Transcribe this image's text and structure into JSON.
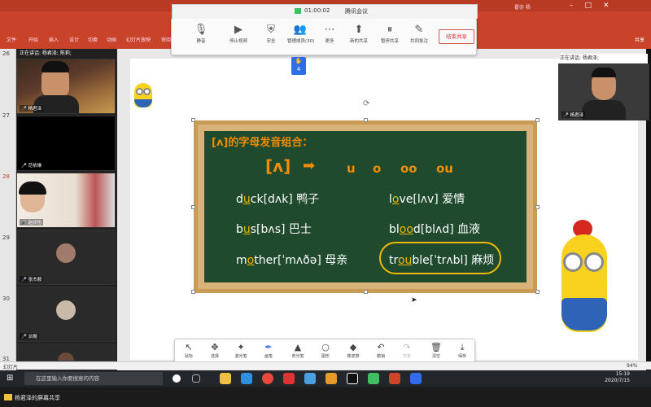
{
  "ribbon": {
    "tabs": [
      "文件",
      "开始",
      "插入",
      "设计",
      "切换",
      "动画",
      "幻灯片放映",
      "审阅"
    ],
    "share": "共享",
    "user": "翟亦 杨"
  },
  "meeting": {
    "time": "01:00:02",
    "name": "腾讯会议",
    "tools": [
      {
        "icon": "microphone-icon",
        "label": "静音"
      },
      {
        "icon": "camera-icon",
        "label": "停止视频"
      },
      {
        "icon": "shield-icon",
        "label": "安全"
      },
      {
        "icon": "members-icon",
        "label": "管理成员(30)"
      },
      {
        "icon": "more-icon",
        "label": "更多"
      },
      {
        "icon": "new-share-icon",
        "label": "新的共享"
      },
      {
        "icon": "pause-share-icon",
        "label": "暂停共享"
      },
      {
        "icon": "annotate-icon",
        "label": "共同批注"
      }
    ],
    "members_badge": "30",
    "end_share": "结束共享",
    "raise_hand_count": "4"
  },
  "slides": {
    "numbers": [
      "26",
      "27",
      "28",
      "29",
      "30",
      "31"
    ]
  },
  "participants": {
    "speaking": "正在讲话: 杨君泽; 陈莉;",
    "tiles": [
      {
        "name": "杨君泽"
      },
      {
        "name": "范依琳"
      },
      {
        "name": "赵欣怡"
      },
      {
        "name": "张杰顺"
      },
      {
        "name": "派帽"
      }
    ]
  },
  "right_speaker": {
    "label": "正在讲话: 杨君泽;",
    "name": "杨君泽"
  },
  "board": {
    "title": "[ʌ]的字母发音组合：",
    "symbol": "[ʌ]",
    "vowels": [
      "u",
      "o",
      "oo",
      "ou"
    ],
    "words": [
      {
        "pre": "d",
        "hl": "u",
        "post": "ck[dʌk] 鸭子"
      },
      {
        "pre": "l",
        "hl": "o",
        "post": "ve[lʌv] 爱情"
      },
      {
        "pre": "b",
        "hl": "u",
        "post": "s[bʌs]  巴士"
      },
      {
        "pre": "bl",
        "hl": "oo",
        "post": "d[blʌd] 血液"
      },
      {
        "pre": "m",
        "hl": "o",
        "post": "ther[ˈmʌðə] 母亲"
      },
      {
        "pre": "tr",
        "hl": "ou",
        "post": "ble[ˈtrʌbl] 麻烦"
      }
    ]
  },
  "drawbar": {
    "tools": [
      {
        "icon": "pointer-icon",
        "label": "鼠标"
      },
      {
        "icon": "move-icon",
        "label": "选择"
      },
      {
        "icon": "laser-icon",
        "label": "激光笔"
      },
      {
        "icon": "pen-icon",
        "label": "画笔"
      },
      {
        "icon": "highlighter-icon",
        "label": "荧光笔"
      },
      {
        "icon": "shape-icon",
        "label": "图形"
      },
      {
        "icon": "eraser-icon",
        "label": "橡皮擦"
      },
      {
        "icon": "undo-icon",
        "label": "撤销"
      },
      {
        "icon": "redo-icon",
        "label": "恢复"
      },
      {
        "icon": "trash-icon",
        "label": "清空"
      },
      {
        "icon": "save-icon",
        "label": "保存"
      }
    ]
  },
  "statusbar": {
    "left": "幻灯片",
    "zoom": "94%"
  },
  "taskbar": {
    "search_placeholder": "在这里输入你要搜索的内容",
    "time": "15:19",
    "date": "2020/7/15"
  },
  "sharebar": {
    "label": "杨君泽的屏幕共享"
  }
}
